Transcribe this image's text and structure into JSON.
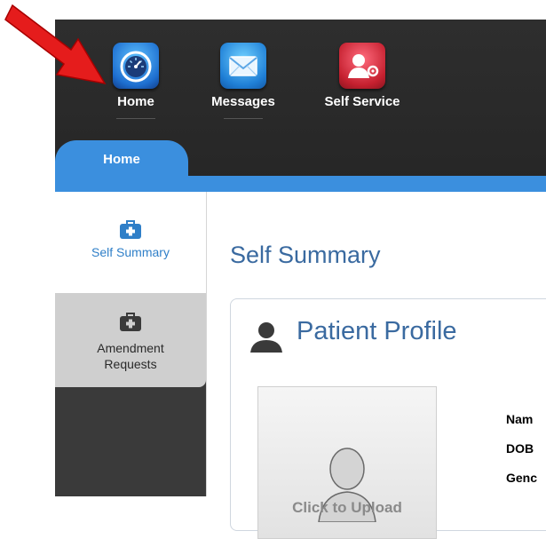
{
  "toolbar": {
    "apps": [
      {
        "label": "Home",
        "icon": "dashboard-gauge-icon"
      },
      {
        "label": "Messages",
        "icon": "envelope-icon"
      },
      {
        "label": "Self Service",
        "icon": "person-gear-icon"
      }
    ]
  },
  "tabs": [
    {
      "label": "Home",
      "active": true
    }
  ],
  "sidebar": {
    "items": [
      {
        "label": "Self Summary",
        "icon": "medical-bag-icon",
        "active": true
      },
      {
        "label_line1": "Amendment",
        "label_line2": "Requests",
        "icon": "medical-bag-icon",
        "active": false
      }
    ]
  },
  "main": {
    "title": "Self Summary",
    "card": {
      "title": "Patient Profile",
      "photo_label": "Click to Upload",
      "fields": [
        "Nam",
        "DOB",
        "Genc"
      ]
    }
  },
  "colors": {
    "topbar": "#2b2b2b",
    "accent_blue": "#3b8fde",
    "title_blue": "#3a6aa0",
    "annotation_arrow": "#e51c1c"
  }
}
